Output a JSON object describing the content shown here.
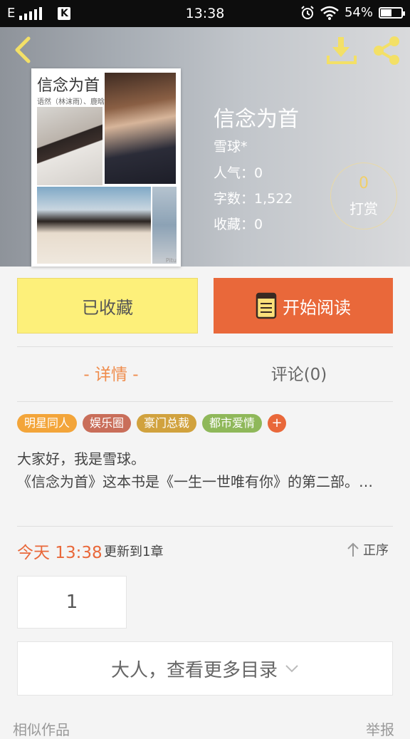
{
  "status_bar": {
    "network": "E",
    "time": "13:38",
    "battery": "54%",
    "battery_level": 0.54
  },
  "header_icons": [
    "back-arrow-icon",
    "download-icon",
    "share-icon"
  ],
  "cover": {
    "title": "信念为首",
    "subtitle": "语然（林沫雨）、鹿晗",
    "watermark": "Pitu"
  },
  "book": {
    "title": "信念为首",
    "author": "雪球*",
    "popularity": "人气：0",
    "word_count": "字数：1,522",
    "favorites": "收藏：0"
  },
  "reward": {
    "count": "0",
    "label": "打赏"
  },
  "actions": {
    "collected_label": "已收藏",
    "read_label": "开始阅读"
  },
  "tabs": {
    "detail": "- 详情 -",
    "comments": "评论(0)"
  },
  "tags": [
    {
      "label": "明星同人",
      "color": "#f3a53a"
    },
    {
      "label": "娱乐圈",
      "color": "#c96e5a"
    },
    {
      "label": "豪门总裁",
      "color": "#d1a23e"
    },
    {
      "label": "都市爱情",
      "color": "#8fb85a"
    }
  ],
  "tag_add": "+",
  "description": {
    "line1": "大家好，我是雪球。",
    "line2": "《信念为首》这本书是《一生一世唯有你》的第二部。…"
  },
  "update": {
    "time": "今天 13:38",
    "text": "更新到1章",
    "sort_label": "正序"
  },
  "chapter": "1",
  "more_catalog": "大人，查看更多目录",
  "footer": {
    "similar": "相似作品",
    "report": "举报"
  },
  "colors": {
    "accent_orange": "#e9683a",
    "collect_yellow": "#fdf07a",
    "tab_active": "#ef8c4c"
  }
}
